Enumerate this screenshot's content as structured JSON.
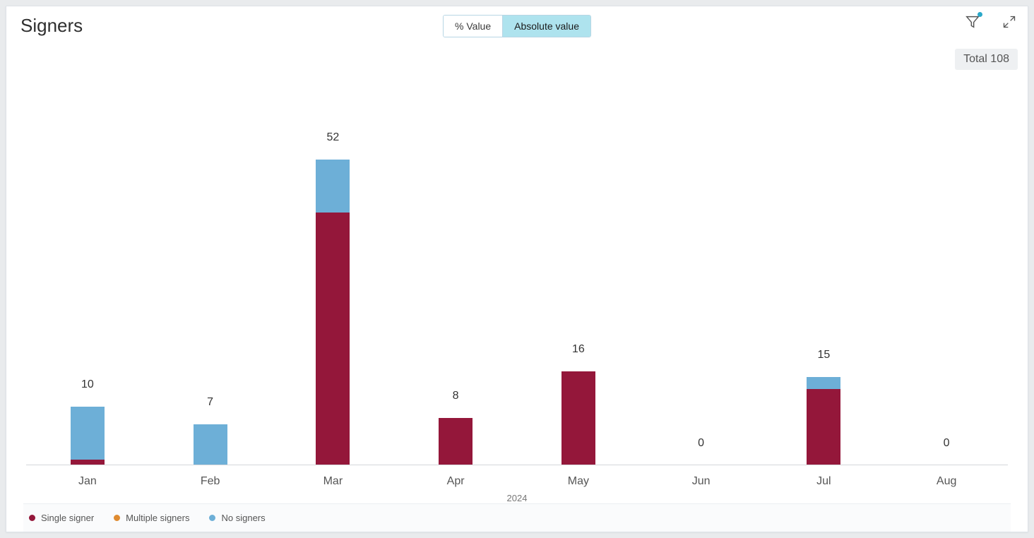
{
  "title": "Signers",
  "toggle": {
    "percent_label": "% Value",
    "absolute_label": "Absolute value",
    "active": "absolute"
  },
  "total_badge": "Total 108",
  "year_label": "2024",
  "legend": [
    {
      "name": "Single signer",
      "color": "#94173a"
    },
    {
      "name": "Multiple signers",
      "color": "#df8b30"
    },
    {
      "name": "No signers",
      "color": "#6dafd7"
    }
  ],
  "chart_data": {
    "type": "bar",
    "stacked": true,
    "title": "Signers",
    "xlabel": "2024",
    "ylabel": "",
    "ylim": [
      0,
      60
    ],
    "categories": [
      "Jan",
      "Feb",
      "Mar",
      "Apr",
      "May",
      "Jun",
      "Jul",
      "Aug"
    ],
    "series": [
      {
        "name": "Single signer",
        "key": "single",
        "values": [
          1,
          0,
          43,
          8,
          16,
          0,
          13,
          0
        ]
      },
      {
        "name": "Multiple signers",
        "key": "multiple",
        "values": [
          0,
          0,
          0,
          0,
          0,
          0,
          0,
          0
        ]
      },
      {
        "name": "No signers",
        "key": "nosigners",
        "values": [
          9,
          7,
          9,
          0,
          0,
          0,
          2,
          0
        ]
      }
    ],
    "totals": [
      10,
      7,
      52,
      8,
      16,
      0,
      15,
      0
    ]
  }
}
